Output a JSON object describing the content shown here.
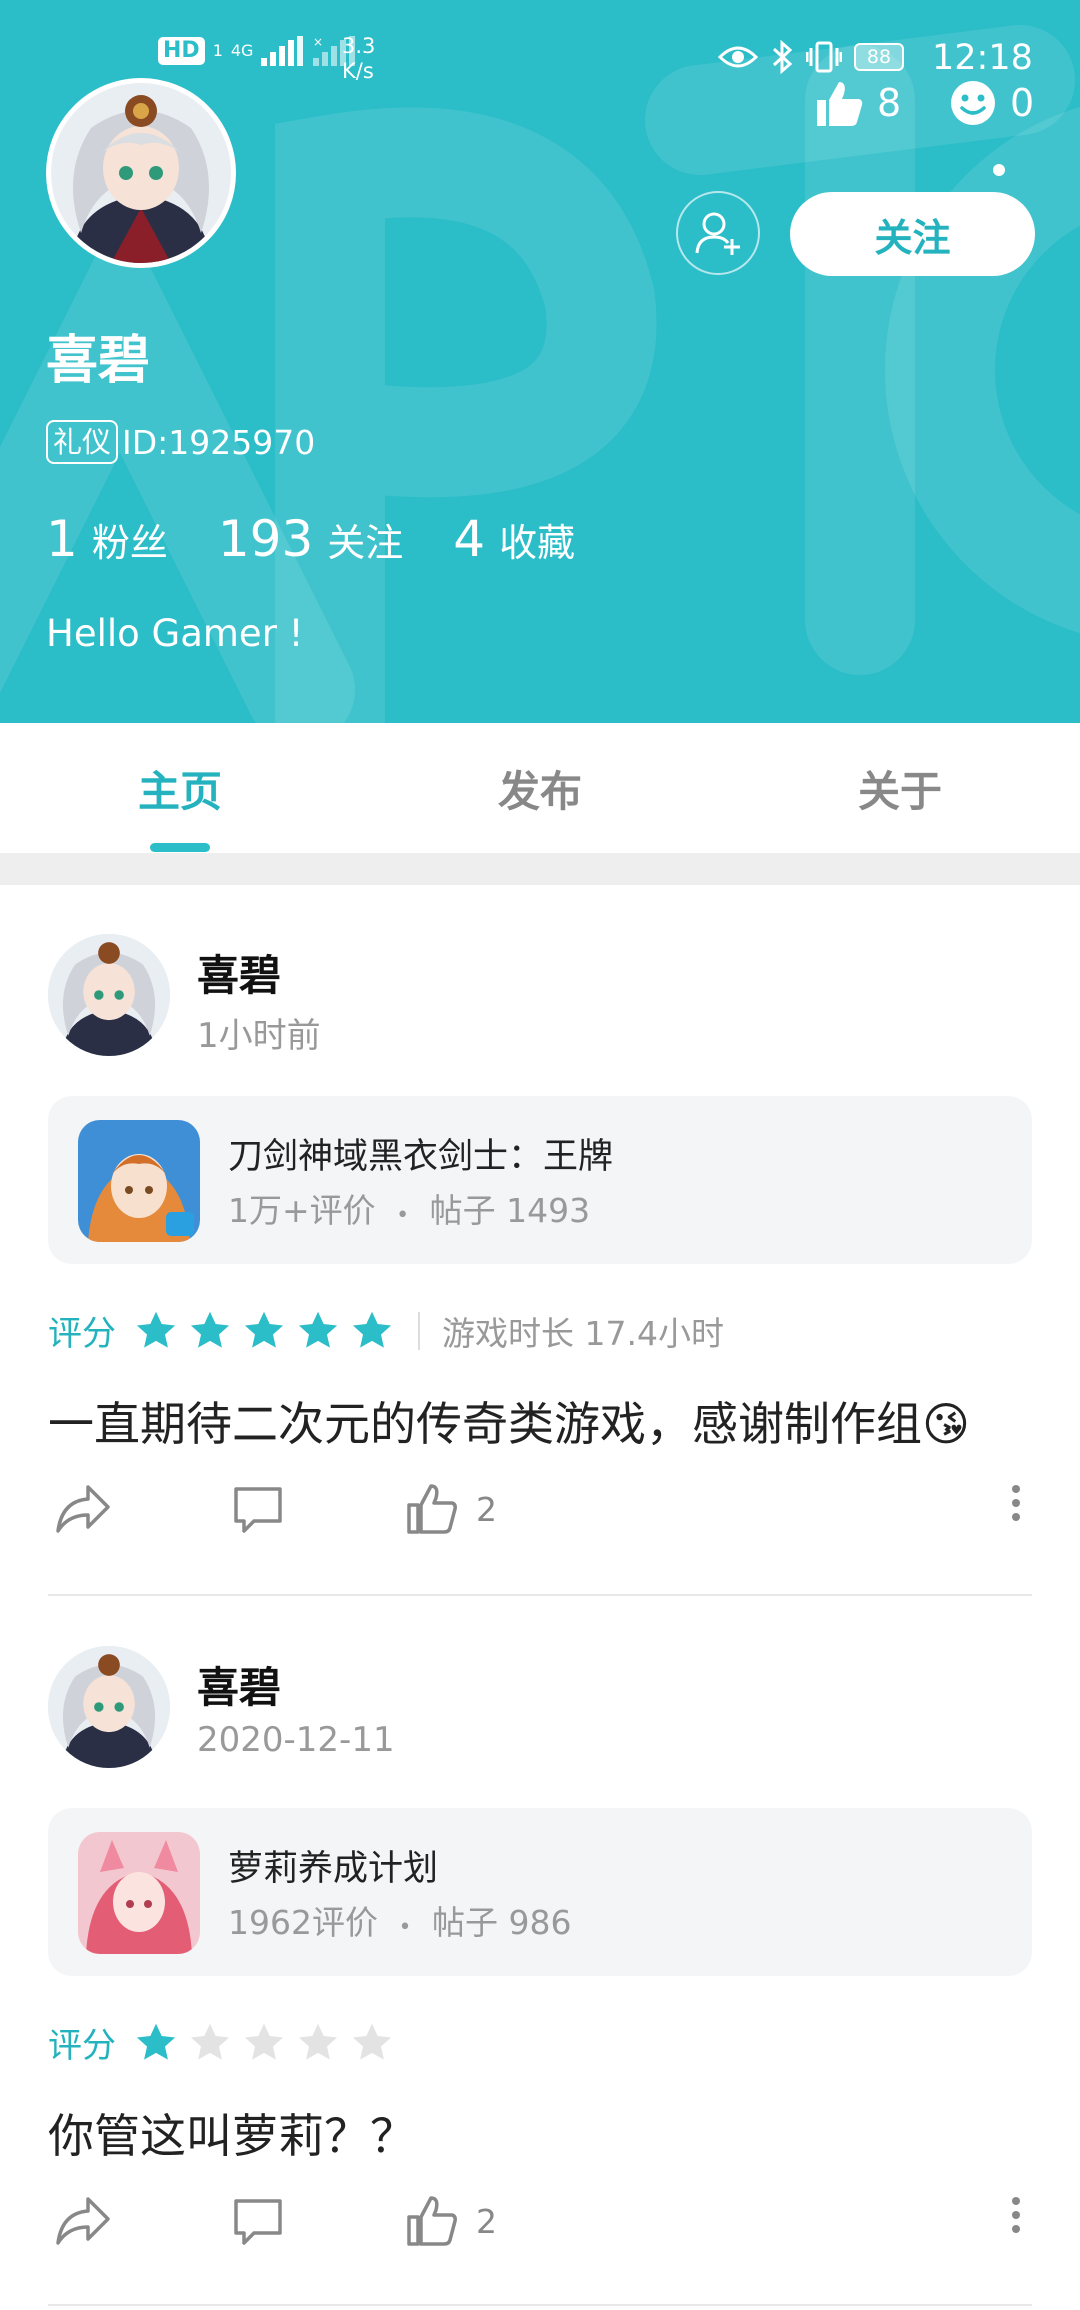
{
  "status_bar": {
    "hd_label": "HD",
    "sim_label": "1",
    "net_label": "4G",
    "speed_value": "3.3",
    "speed_unit": "K/s",
    "battery": "88",
    "time": "12:18"
  },
  "profile": {
    "likes_count": "8",
    "emoji_count": "0",
    "follow_label": "关注",
    "name": "喜碧",
    "badge": "礼仪",
    "id_text": "ID:1925970",
    "stats": [
      {
        "num": "1",
        "label": "粉丝"
      },
      {
        "num": "193",
        "label": "关注"
      },
      {
        "num": "4",
        "label": "收藏"
      }
    ],
    "bio": "Hello Gamer !",
    "colors": {
      "header_bg": "#2bbdc8",
      "accent": "#24b3be"
    }
  },
  "tabs": [
    {
      "label": "主页",
      "active": true
    },
    {
      "label": "发布",
      "active": false
    },
    {
      "label": "关于",
      "active": false
    }
  ],
  "posts": [
    {
      "author": "喜碧",
      "time": "1小时前",
      "game": {
        "title": "刀剑神域黑衣剑士：王牌",
        "reviews": "1万+评价",
        "dot": "•",
        "posts": "帖子 1493"
      },
      "rating_label": "评分",
      "rating": 5,
      "playtime": "游戏时长 17.4小时",
      "text": "一直期待二次元的传奇类游戏，感谢制作组😘",
      "likes": "2"
    },
    {
      "author": "喜碧",
      "time": "2020-12-11",
      "game": {
        "title": "萝莉养成计划",
        "reviews": "1962评价",
        "dot": "•",
        "posts": "帖子 986"
      },
      "rating_label": "评分",
      "rating": 1,
      "playtime": "",
      "text": "你管这叫萝莉？？",
      "likes": "2"
    }
  ]
}
